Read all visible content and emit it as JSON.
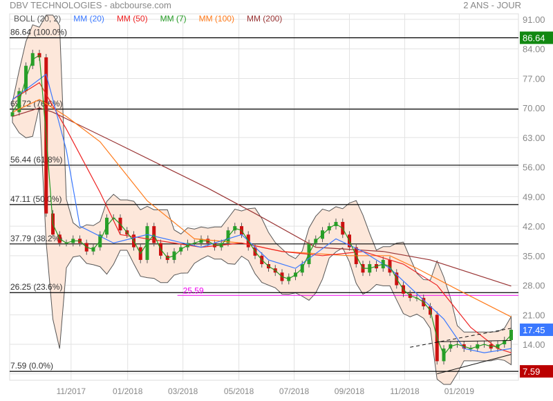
{
  "header": {
    "title": "DBV TECHNOLOGIES - abcbourse.com",
    "period": "2 ANS - JOUR"
  },
  "legend": [
    {
      "label": "BOLL (20, 2)",
      "color": "#555555"
    },
    {
      "label": "MM (20)",
      "color": "#3a78ff"
    },
    {
      "label": "MM (50)",
      "color": "#ee2222"
    },
    {
      "label": "MM (7)",
      "color": "#229922"
    },
    {
      "label": "MM (100)",
      "color": "#ff7a1a"
    },
    {
      "label": "MM (200)",
      "color": "#993333"
    }
  ],
  "chart_data": {
    "type": "candlestick",
    "title": "DBV TECHNOLOGIES",
    "ylim": [
      4,
      93
    ],
    "y_ticks": [
      "91.00",
      "84.00",
      "77.00",
      "70.00",
      "63.00",
      "56.00",
      "49.00",
      "42.00",
      "35.00",
      "28.00",
      "21.00",
      "14.00"
    ],
    "y_tick_values": [
      91,
      84,
      77,
      70,
      63,
      56,
      49,
      42,
      35,
      28,
      21,
      14
    ],
    "x_ticks": [
      {
        "label": "11/2017",
        "week": 8.7
      },
      {
        "label": "01/2018",
        "week": 17.1
      },
      {
        "label": "03/2018",
        "week": 25.3
      },
      {
        "label": "05/2018",
        "week": 33.6
      },
      {
        "label": "07/2018",
        "week": 41.8
      },
      {
        "label": "09/2018",
        "week": 50.0
      },
      {
        "label": "11/2018",
        "week": 58.2
      },
      {
        "label": "01/2019",
        "week": 66.3
      }
    ],
    "weekly_close": [
      69,
      74,
      80,
      83,
      82,
      45,
      40,
      38,
      38,
      39,
      38,
      36,
      37,
      40,
      44,
      44,
      41,
      40,
      37,
      34,
      42,
      38,
      35,
      34,
      36,
      37,
      38,
      38,
      39,
      38,
      37,
      38,
      41,
      42,
      40,
      37,
      35,
      33,
      32,
      31,
      29,
      30,
      31,
      33,
      38,
      39,
      41,
      42,
      43,
      40,
      37,
      33,
      31,
      33,
      32,
      34,
      31,
      28,
      26,
      25,
      25,
      23,
      21,
      10,
      13,
      14,
      14,
      13,
      13,
      14,
      14,
      13,
      14,
      15,
      17.45
    ],
    "ma": {
      "MM200": [
        [
          0,
          68
        ],
        [
          4,
          70
        ],
        [
          6,
          69
        ],
        [
          15,
          62
        ],
        [
          29,
          51
        ],
        [
          36,
          45
        ],
        [
          45,
          37
        ],
        [
          55,
          36
        ],
        [
          62,
          34
        ],
        [
          74,
          27.8
        ]
      ],
      "MM100": [
        [
          0,
          69
        ],
        [
          4,
          72
        ],
        [
          8,
          68
        ],
        [
          13,
          62
        ],
        [
          20,
          48
        ],
        [
          27,
          39
        ],
        [
          34,
          38
        ],
        [
          40,
          36
        ],
        [
          50,
          35
        ],
        [
          56,
          35
        ],
        [
          60,
          32
        ],
        [
          66,
          27
        ],
        [
          74,
          20.5
        ]
      ],
      "MM50": [
        [
          0,
          72
        ],
        [
          4,
          76
        ],
        [
          8,
          65
        ],
        [
          13,
          50
        ],
        [
          16,
          40
        ],
        [
          20,
          39
        ],
        [
          28,
          37
        ],
        [
          34,
          38
        ],
        [
          40,
          36
        ],
        [
          46,
          35
        ],
        [
          52,
          36
        ],
        [
          58,
          33
        ],
        [
          63,
          28
        ],
        [
          68,
          18
        ],
        [
          72,
          13
        ],
        [
          74,
          12
        ]
      ],
      "MM20": [
        [
          0,
          72
        ],
        [
          5,
          78
        ],
        [
          8,
          60
        ],
        [
          10,
          42
        ],
        [
          15,
          38
        ],
        [
          20,
          40
        ],
        [
          28,
          37
        ],
        [
          34,
          40
        ],
        [
          38,
          34
        ],
        [
          42,
          32
        ],
        [
          48,
          39
        ],
        [
          52,
          36
        ],
        [
          56,
          32
        ],
        [
          60,
          26
        ],
        [
          64,
          20
        ],
        [
          67,
          13
        ],
        [
          70,
          12
        ],
        [
          74,
          13
        ]
      ]
    },
    "fibonacci": [
      {
        "value": 86.64,
        "label": "86.64  (100.0%)"
      },
      {
        "value": 69.72,
        "label": "69.72  (76.6%)"
      },
      {
        "value": 56.44,
        "label": "56.44  (61.8%)"
      },
      {
        "value": 47.11,
        "label": "47.11  (50.0%)"
      },
      {
        "value": 37.79,
        "label": "37.79  (38.2%)"
      },
      {
        "value": 26.25,
        "label": "26.25  (23.6%)"
      },
      {
        "value": 7.59,
        "label": "7.59  (0.0%)"
      }
    ],
    "horizontal_line": {
      "value": 25.59,
      "label": "25.59",
      "color": "#ee00ee",
      "from_week": 25.5
    },
    "last_price": {
      "value": "17.45",
      "color": "#3a78ff"
    },
    "high_marker": {
      "value": "86.64",
      "color": "#118811"
    },
    "low_marker": {
      "value": "7.59",
      "color": "#bb0000"
    },
    "trendlines": [
      {
        "style": "dashed",
        "from": [
          59,
          13.3
        ],
        "to": [
          74,
          17.8
        ]
      },
      {
        "style": "solid",
        "from": [
          63,
          14.6
        ],
        "to": [
          74,
          14.9
        ]
      },
      {
        "style": "solid",
        "from": [
          63,
          7
        ],
        "to": [
          74,
          11.6
        ]
      }
    ]
  }
}
